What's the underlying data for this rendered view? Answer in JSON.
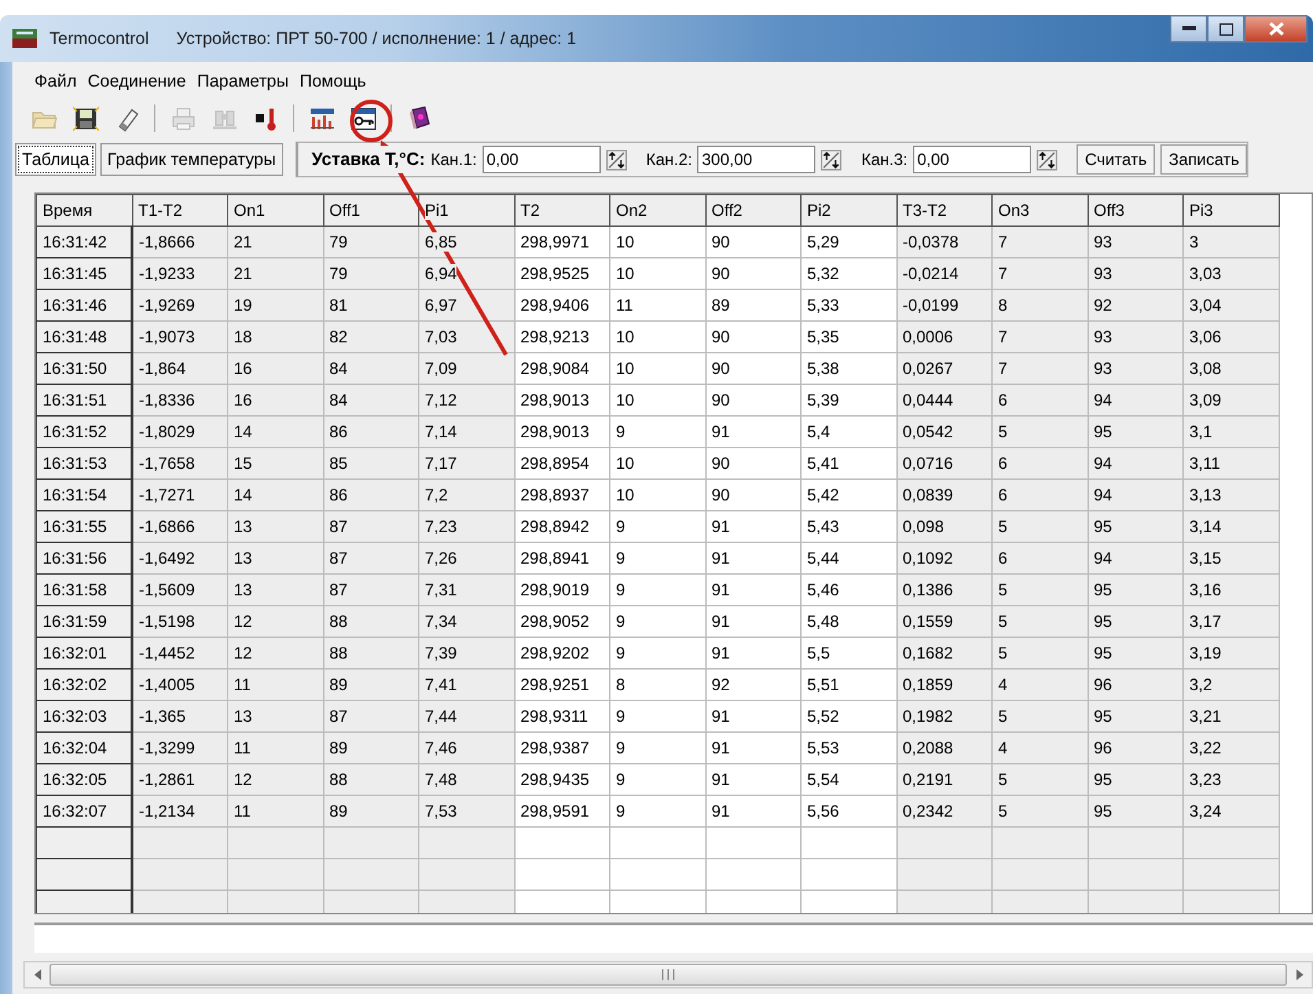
{
  "window": {
    "app_name": "Termocontrol",
    "title": "Устройство: ПРТ 50-700 / исполнение: 1 / адрес: 1"
  },
  "menu": [
    "Файл",
    "Соединение",
    "Параметры",
    "Помощь"
  ],
  "toolbar": [
    {
      "kind": "open",
      "disabled": true
    },
    {
      "kind": "save",
      "disabled": false
    },
    {
      "kind": "eraser",
      "disabled": false
    },
    {
      "kind": "separator"
    },
    {
      "kind": "printer",
      "disabled": true
    },
    {
      "kind": "binoculars",
      "disabled": true
    },
    {
      "kind": "thermometer",
      "disabled": false
    },
    {
      "kind": "separator"
    },
    {
      "kind": "chart",
      "disabled": false
    },
    {
      "kind": "key",
      "disabled": false
    },
    {
      "kind": "separator"
    },
    {
      "kind": "book",
      "disabled": false
    }
  ],
  "tabs": [
    {
      "label": "Таблица",
      "selected": true
    },
    {
      "label": "График температуры",
      "selected": false
    }
  ],
  "setpoint": {
    "label": "Уставка Т,°С:",
    "channels": [
      {
        "label": "Кан.1:",
        "value": "0,00"
      },
      {
        "label": "Кан.2:",
        "value": "300,00"
      },
      {
        "label": "Кан.3:",
        "value": "0,00"
      }
    ],
    "buttons": [
      "Считать",
      "Записать"
    ]
  },
  "table": {
    "columns": [
      {
        "label": "Время",
        "kind": "fixed"
      },
      {
        "label": "T1-T2",
        "kind": "shaded"
      },
      {
        "label": "On1",
        "kind": "shaded"
      },
      {
        "label": "Off1",
        "kind": "shaded"
      },
      {
        "label": "Pi1",
        "kind": "shaded"
      },
      {
        "label": "T2",
        "kind": "plain"
      },
      {
        "label": "On2",
        "kind": "plain"
      },
      {
        "label": "Off2",
        "kind": "plain"
      },
      {
        "label": "Pi2",
        "kind": "plain"
      },
      {
        "label": "T3-T2",
        "kind": "shaded"
      },
      {
        "label": "On3",
        "kind": "shaded"
      },
      {
        "label": "Off3",
        "kind": "shaded"
      },
      {
        "label": "Pi3",
        "kind": "shaded"
      }
    ],
    "rows": [
      [
        "16:31:42",
        "-1,8666",
        "21",
        "79",
        "6,85",
        "298,9971",
        "10",
        "90",
        "5,29",
        "-0,0378",
        "7",
        "93",
        "3"
      ],
      [
        "16:31:45",
        "-1,9233",
        "21",
        "79",
        "6,94",
        "298,9525",
        "10",
        "90",
        "5,32",
        "-0,0214",
        "7",
        "93",
        "3,03"
      ],
      [
        "16:31:46",
        "-1,9269",
        "19",
        "81",
        "6,97",
        "298,9406",
        "11",
        "89",
        "5,33",
        "-0,0199",
        "8",
        "92",
        "3,04"
      ],
      [
        "16:31:48",
        "-1,9073",
        "18",
        "82",
        "7,03",
        "298,9213",
        "10",
        "90",
        "5,35",
        "0,0006",
        "7",
        "93",
        "3,06"
      ],
      [
        "16:31:50",
        "-1,864",
        "16",
        "84",
        "7,09",
        "298,9084",
        "10",
        "90",
        "5,38",
        "0,0267",
        "7",
        "93",
        "3,08"
      ],
      [
        "16:31:51",
        "-1,8336",
        "16",
        "84",
        "7,12",
        "298,9013",
        "10",
        "90",
        "5,39",
        "0,0444",
        "6",
        "94",
        "3,09"
      ],
      [
        "16:31:52",
        "-1,8029",
        "14",
        "86",
        "7,14",
        "298,9013",
        "9",
        "91",
        "5,4",
        "0,0542",
        "5",
        "95",
        "3,1"
      ],
      [
        "16:31:53",
        "-1,7658",
        "15",
        "85",
        "7,17",
        "298,8954",
        "10",
        "90",
        "5,41",
        "0,0716",
        "6",
        "94",
        "3,11"
      ],
      [
        "16:31:54",
        "-1,7271",
        "14",
        "86",
        "7,2",
        "298,8937",
        "10",
        "90",
        "5,42",
        "0,0839",
        "6",
        "94",
        "3,13"
      ],
      [
        "16:31:55",
        "-1,6866",
        "13",
        "87",
        "7,23",
        "298,8942",
        "9",
        "91",
        "5,43",
        "0,098",
        "5",
        "95",
        "3,14"
      ],
      [
        "16:31:56",
        "-1,6492",
        "13",
        "87",
        "7,26",
        "298,8941",
        "9",
        "91",
        "5,44",
        "0,1092",
        "6",
        "94",
        "3,15"
      ],
      [
        "16:31:58",
        "-1,5609",
        "13",
        "87",
        "7,31",
        "298,9019",
        "9",
        "91",
        "5,46",
        "0,1386",
        "5",
        "95",
        "3,16"
      ],
      [
        "16:31:59",
        "-1,5198",
        "12",
        "88",
        "7,34",
        "298,9052",
        "9",
        "91",
        "5,48",
        "0,1559",
        "5",
        "95",
        "3,17"
      ],
      [
        "16:32:01",
        "-1,4452",
        "12",
        "88",
        "7,39",
        "298,9202",
        "9",
        "91",
        "5,5",
        "0,1682",
        "5",
        "95",
        "3,19"
      ],
      [
        "16:32:02",
        "-1,4005",
        "11",
        "89",
        "7,41",
        "298,9251",
        "8",
        "92",
        "5,51",
        "0,1859",
        "4",
        "96",
        "3,2"
      ],
      [
        "16:32:03",
        "-1,365",
        "13",
        "87",
        "7,44",
        "298,9311",
        "9",
        "91",
        "5,52",
        "0,1982",
        "5",
        "95",
        "3,21"
      ],
      [
        "16:32:04",
        "-1,3299",
        "11",
        "89",
        "7,46",
        "298,9387",
        "9",
        "91",
        "5,53",
        "0,2088",
        "4",
        "96",
        "3,22"
      ],
      [
        "16:32:05",
        "-1,2861",
        "12",
        "88",
        "7,48",
        "298,9435",
        "9",
        "91",
        "5,54",
        "0,2191",
        "5",
        "95",
        "3,23"
      ],
      [
        "16:32:07",
        "-1,2134",
        "11",
        "89",
        "7,53",
        "298,9591",
        "9",
        "91",
        "5,56",
        "0,2342",
        "5",
        "95",
        "3,24"
      ]
    ]
  }
}
